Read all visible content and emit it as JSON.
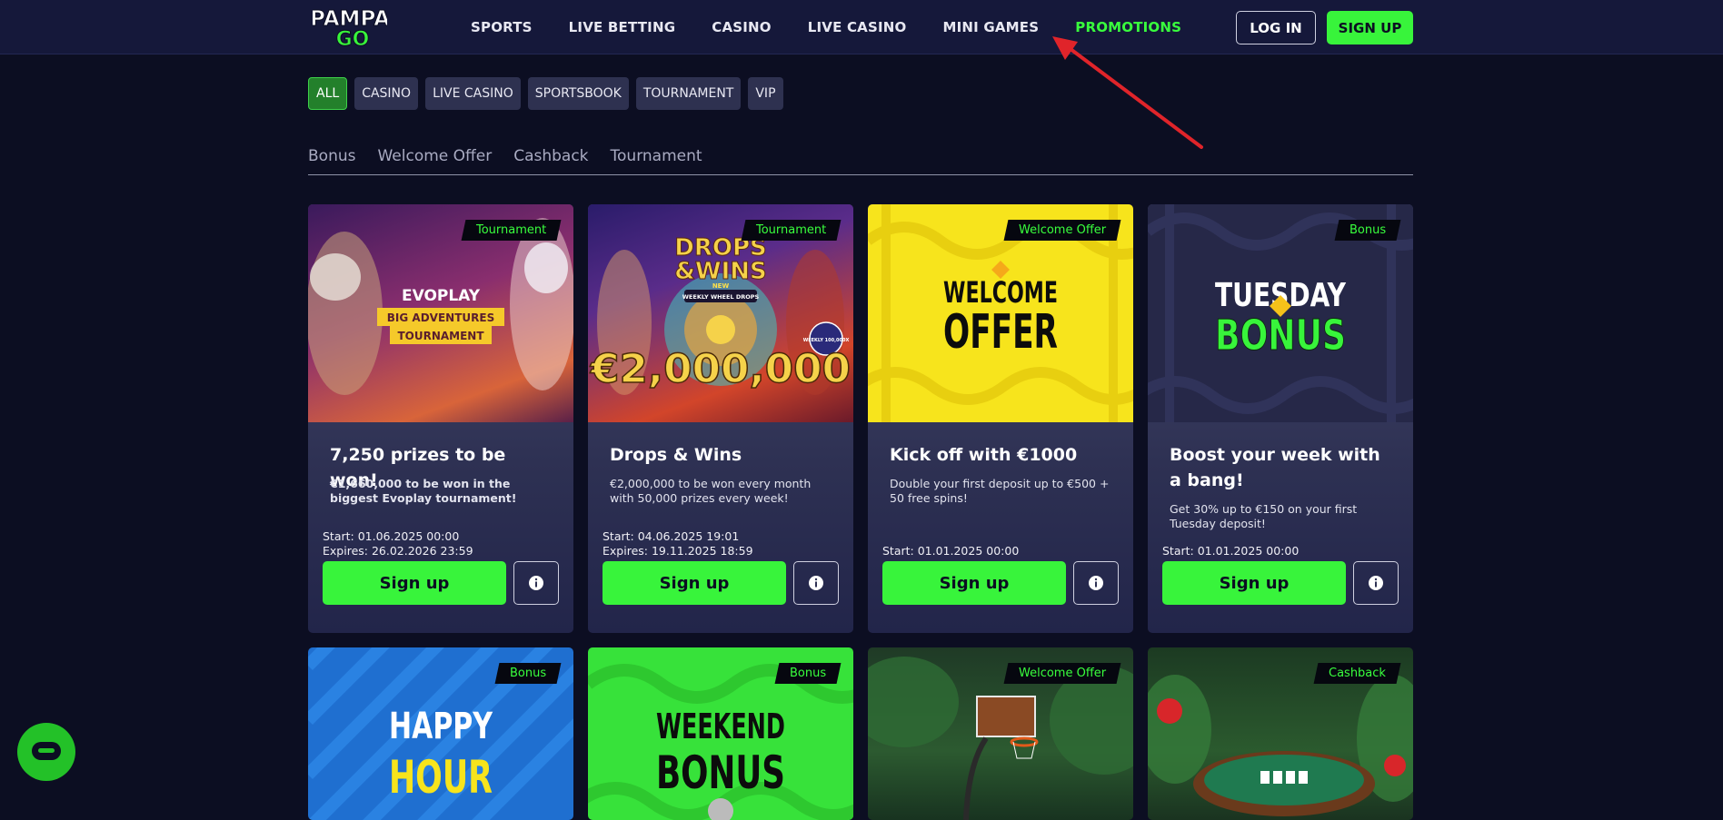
{
  "header": {
    "logo_top": "PAMPA",
    "logo_bottom": "GO",
    "nav": [
      "SPORTS",
      "LIVE BETTING",
      "CASINO",
      "LIVE CASINO",
      "MINI GAMES",
      "PROMOTIONS"
    ],
    "active_nav": "PROMOTIONS",
    "login_label": "LOG IN",
    "signup_label": "SIGN UP"
  },
  "filters": [
    "ALL",
    "CASINO",
    "LIVE CASINO",
    "SPORTSBOOK",
    "TOURNAMENT",
    "VIP"
  ],
  "active_filter": "ALL",
  "subtabs": [
    "Bonus",
    "Welcome Offer",
    "Cashback",
    "Tournament"
  ],
  "cards": [
    {
      "tag": "Tournament",
      "banner_brand": "EVOPLAY",
      "banner_line1": "BIG ADVENTURES",
      "banner_line2": "TOURNAMENT",
      "title": "7,250 prizes to be won!",
      "desc": "€1,660,000 to be won in the biggest Evoplay tournament!",
      "start": "Start: 01.06.2025 00:00",
      "expires": "Expires: 26.02.2026 23:59",
      "cta": "Sign up"
    },
    {
      "tag": "Tournament",
      "banner_line1": "DROPS",
      "banner_line2": "&WINS",
      "banner_sub": "WEEKLY WHEEL DROPS",
      "banner_badge": "NEW",
      "banner_amount": "€2,000,000",
      "banner_weekly": "WEEKLY 100,000X",
      "title": "Drops & Wins",
      "desc": "€2,000,000 to be won every month with 50,000 prizes every week!",
      "start": "Start: 04.06.2025 19:01",
      "expires": "Expires: 19.11.2025 18:59",
      "cta": "Sign up"
    },
    {
      "tag": "Welcome Offer",
      "banner_line1": "WELCOME",
      "banner_line2": "OFFER",
      "title": "Kick off with €1000",
      "desc": "Double your first deposit up to €500 + 50 free spins!",
      "start": "Start: 01.01.2025 00:00",
      "cta": "Sign up"
    },
    {
      "tag": "Bonus",
      "banner_line1": "TUESDAY",
      "banner_line2": "BONUS",
      "title": "Boost your week with a bang!",
      "desc": "Get 30% up to €150 on your first Tuesday deposit!",
      "start": "Start: 01.01.2025 00:00",
      "cta": "Sign up"
    }
  ],
  "cards_row2": [
    {
      "tag": "Bonus",
      "banner_line1": "HAPPY",
      "banner_line2": "HOUR"
    },
    {
      "tag": "Bonus",
      "banner_line1": "WEEKEND",
      "banner_line2": "BONUS"
    },
    {
      "tag": "Welcome Offer"
    },
    {
      "tag": "Cashback"
    }
  ],
  "colors": {
    "accent": "#38f43b",
    "bg": "#0c0e22",
    "header": "#15183a",
    "arrow": "#e0242a"
  },
  "icons": {
    "info": "info-icon",
    "chat": "chat-icon"
  }
}
